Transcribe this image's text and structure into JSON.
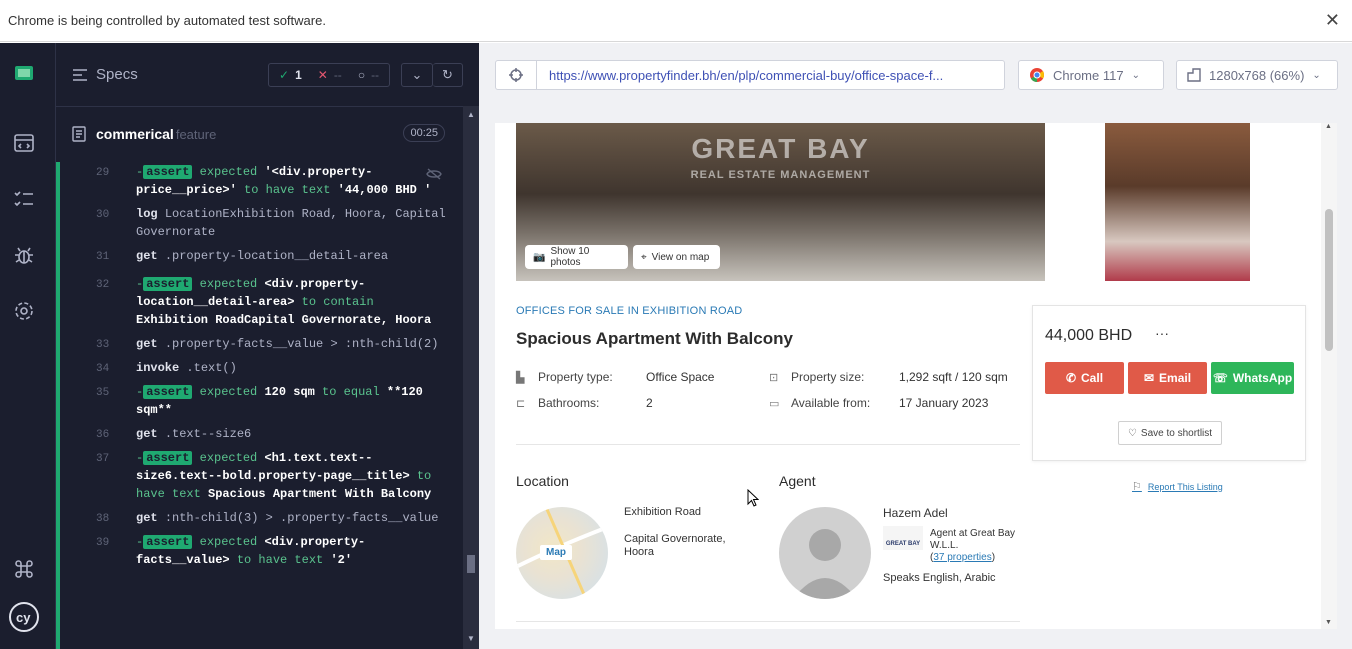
{
  "banner": {
    "text": "Chrome is being controlled by automated test software.",
    "close": "✕"
  },
  "reporter": {
    "specs_label": "Specs",
    "stats": {
      "passed": "1",
      "failed": "--",
      "pending": "--"
    },
    "file": {
      "name": "commerical",
      "kind": "feature",
      "duration": "00:25"
    },
    "commands": [
      {
        "num": "29",
        "type": "assert",
        "parts": [
          "expected ",
          "'<div.property-price__price>'",
          " to have text ",
          "'44,000 BHD '"
        ]
      },
      {
        "num": "30",
        "name": "log",
        "message": "LocationExhibition Road, Hoora, Capital Governorate"
      },
      {
        "num": "31",
        "name": "get",
        "message": ".property-location__detail-area"
      },
      {
        "num": "32",
        "type": "assert",
        "parts": [
          "expected ",
          "<div.property-location__detail-area>",
          " to contain ",
          "Exhibition RoadCapital Governorate, Hoora"
        ]
      },
      {
        "num": "33",
        "name": "get",
        "message": ".property-facts__value > :nth-child(2)"
      },
      {
        "num": "34",
        "name": "invoke",
        "message": ".text()"
      },
      {
        "num": "35",
        "type": "assert",
        "parts": [
          "expected ",
          "120 sqm",
          " to equal ",
          "**120 sqm**"
        ]
      },
      {
        "num": "36",
        "name": "get",
        "message": ".text--size6"
      },
      {
        "num": "37",
        "type": "assert",
        "parts": [
          "expected ",
          "<h1.text.text--size6.text--bold.property-page__title>",
          " to have text ",
          "Spacious Apartment With Balcony"
        ]
      },
      {
        "num": "38",
        "name": "get",
        "message": ":nth-child(3) > .property-facts__value"
      },
      {
        "num": "39",
        "type": "assert",
        "parts": [
          "expected ",
          "<div.property-facts__value>",
          " to have text ",
          "'2'"
        ]
      }
    ],
    "assert_label": "-assert"
  },
  "aut": {
    "url": "https://www.propertyfinder.bh/en/plp/commercial-buy/office-space-f...",
    "browser": "Chrome 117",
    "viewport": "1280x768 (66%)"
  },
  "listing": {
    "watermark_1": "GREAT BAY",
    "watermark_2": "REAL ESTATE MANAGEMENT",
    "show_photos": "Show 10 photos",
    "view_on_map": "View on map",
    "breadcrumb": "OFFICES FOR SALE IN EXHIBITION ROAD",
    "title": "Spacious Apartment With Balcony",
    "facts": {
      "type_label": "Property type:",
      "type_value": "Office Space",
      "size_label": "Property size:",
      "size_value": "1,292 sqft / 120 sqm",
      "bath_label": "Bathrooms:",
      "bath_value": "2",
      "avail_label": "Available from:",
      "avail_value": "17 January 2023"
    },
    "location": {
      "heading": "Location",
      "map_label": "Map",
      "line1": "Exhibition Road",
      "line2": "Capital Governorate,",
      "line3": "Hoora"
    },
    "agent": {
      "heading": "Agent",
      "name": "Hazem Adel",
      "company_line1": "Agent at Great Bay",
      "company_line2": "W.L.L.",
      "properties": "37 properties",
      "languages": "Speaks English, Arabic",
      "logo_text": "GREAT BAY"
    },
    "price": "44,000 BHD",
    "more": "···",
    "call": "Call",
    "email": "Email",
    "whatsapp": "WhatsApp",
    "save": "Save to shortlist",
    "report": "Report This Listing"
  },
  "colors": {
    "call": "#e05a48",
    "email": "#e05a48",
    "whatsapp": "#2eb65a",
    "pass": "#1fa971",
    "sidebar": "#1b1e2e"
  }
}
